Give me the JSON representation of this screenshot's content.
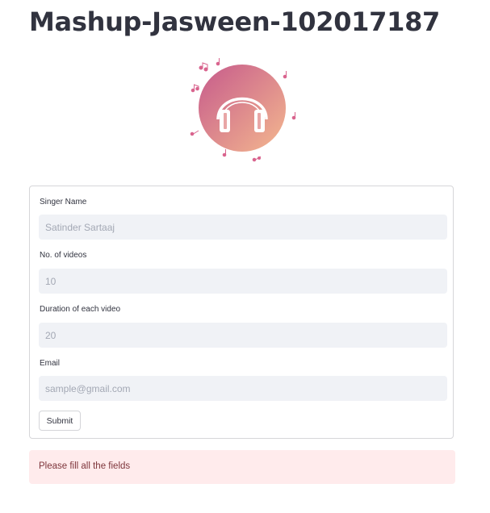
{
  "title": "Mashup-Jasween-102017187",
  "logo": {
    "icon": "headphones-icon",
    "gradient_start": "#c85a8a",
    "gradient_end": "#f2b38f",
    "note_color": "#d9648e"
  },
  "form": {
    "fields": [
      {
        "label": "Singer Name",
        "placeholder": "Satinder Sartaaj"
      },
      {
        "label": "No. of videos",
        "placeholder": "10"
      },
      {
        "label": "Duration of each video",
        "placeholder": "20"
      },
      {
        "label": "Email",
        "placeholder": "sample@gmail.com"
      }
    ],
    "submit_label": "Submit"
  },
  "alert": {
    "message": "Please fill all the fields"
  }
}
